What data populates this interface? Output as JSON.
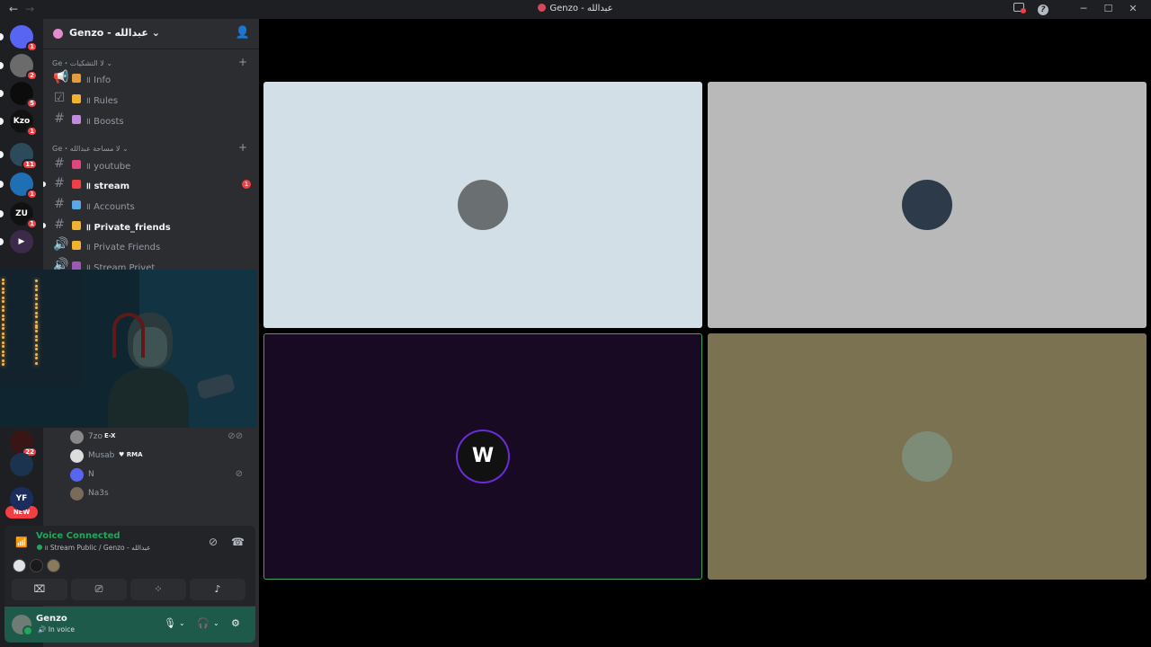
{
  "window": {
    "title": "Genzo - عبدالله",
    "back_icon": "←",
    "forward_icon": "→",
    "minimize_icon": "─",
    "maximize_icon": "☐",
    "close_icon": "✕"
  },
  "rail": {
    "servers": [
      {
        "badge": "1",
        "glyph": "",
        "color": "#5865f2"
      },
      {
        "badge": "2",
        "glyph": "",
        "color": "#6b6b6b"
      },
      {
        "badge": "5",
        "glyph": "",
        "color": "#0c0c0c"
      },
      {
        "badge": "1",
        "glyph": "Kzo",
        "color": "#111111"
      },
      {
        "badge": "11",
        "glyph": "",
        "color": "#2d4a5a"
      },
      {
        "badge": "1",
        "glyph": "",
        "color": "#1f6fb5"
      },
      {
        "badge": "1",
        "glyph": "ZU",
        "color": "#111111"
      },
      {
        "badge": "",
        "glyph": "▶",
        "color": "#3b2a4a"
      },
      {
        "badge": "22",
        "glyph": "",
        "color": "#3a1515"
      },
      {
        "badge": "",
        "glyph": "",
        "color": "#1c3350"
      },
      {
        "badge": "",
        "glyph": "YF",
        "color": "#1a2d5c"
      }
    ],
    "new_label": "NEW"
  },
  "server": {
    "name": "Genzo - عبدالله",
    "chevron": "⌄"
  },
  "categories": [
    {
      "label": "Ge・لا التشكيات ⌄"
    },
    {
      "label": "Ge・لا مساحة عبدالله ⌄"
    }
  ],
  "channels": [
    {
      "label": "॥ Info",
      "hash": "📢",
      "emoji": "#e59a3b",
      "unread": false
    },
    {
      "label": "॥ Rules",
      "hash": "☑",
      "emoji": "#f0b232",
      "unread": false
    },
    {
      "label": "॥ Boosts",
      "hash": "#",
      "emoji": "#c08bd9",
      "unread": false
    },
    {
      "label": "॥ youtube",
      "hash": "#",
      "emoji": "#e0457b",
      "unread": false
    },
    {
      "label": "॥ stream",
      "hash": "#",
      "emoji": "#f23f43",
      "unread": true,
      "count": "1"
    },
    {
      "label": "॥ Accounts",
      "hash": "#",
      "emoji": "#5aa9e6",
      "unread": false
    },
    {
      "label": "॥ Private_friends",
      "hash": "#",
      "emoji": "#f0b232",
      "unread": true
    },
    {
      "label": "॥ Private Friends",
      "hash": "🔊",
      "emoji": "#f0b232",
      "unread": false
    },
    {
      "label": "॥ Stream Privet",
      "hash": "🔊",
      "emoji": "#9b59b6",
      "unread": false
    }
  ],
  "voice_users": [
    {
      "name": "7zo",
      "tag": "E-X",
      "avatar": "#888888"
    },
    {
      "name": "Musab",
      "tag": "♥ RMA",
      "avatar": "#dddddd"
    },
    {
      "name": "N",
      "tag": "",
      "avatar": "#5865f2"
    },
    {
      "name": "Na3s",
      "tag": "",
      "avatar": "#7a6a5a"
    }
  ],
  "voice_panel": {
    "title": "Voice Connected",
    "subtitle": "॥ Stream Public / Genzo - عبدالله",
    "buttons": [
      "camera-off",
      "share-screen",
      "activities",
      "soundboard"
    ]
  },
  "user_panel": {
    "name": "Genzo",
    "status": "In voice"
  },
  "tiles": [
    {
      "bg": "#d2dfe6",
      "avatar": "#6a6f72",
      "border": "none"
    },
    {
      "bg": "#b9b9b9",
      "avatar": "#2d3a4a",
      "border": "none"
    },
    {
      "bg": "#170a22",
      "avatar": "#111111",
      "border": "#3ba55d"
    },
    {
      "bg": "#7a7250",
      "avatar": "#7c8c77",
      "border": "none"
    }
  ],
  "colors": {
    "online": "#23a55a",
    "mention": "#f23f43",
    "brand": "#5865f2"
  }
}
